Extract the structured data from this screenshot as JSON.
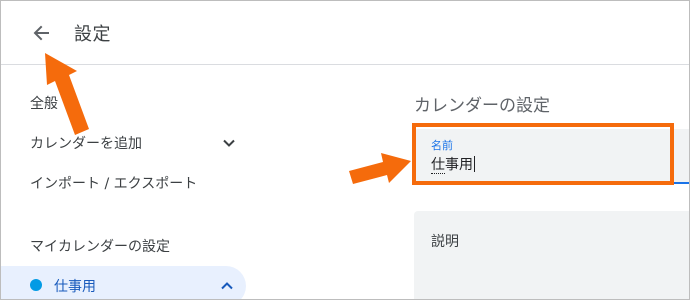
{
  "header": {
    "back_icon": "arrow-left-icon",
    "title": "設定"
  },
  "sidebar": {
    "items": [
      {
        "label": "全般"
      },
      {
        "label": "カレンダーを追加",
        "icon": "chevron-down-icon"
      },
      {
        "label": "インポート / エクスポート"
      }
    ],
    "my_calendars_title": "マイカレンダーの設定",
    "calendar": {
      "label": "仕事用",
      "color": "#039be5",
      "icon": "chevron-up-icon"
    }
  },
  "main": {
    "section_title": "カレンダーの設定",
    "name_field": {
      "label": "名前",
      "value": "仕事用"
    },
    "description_field": {
      "label": "説明"
    }
  },
  "colors": {
    "accent": "#1a73e8",
    "annotation": "#f56b0c",
    "selected_bg": "#e8f0fe"
  }
}
